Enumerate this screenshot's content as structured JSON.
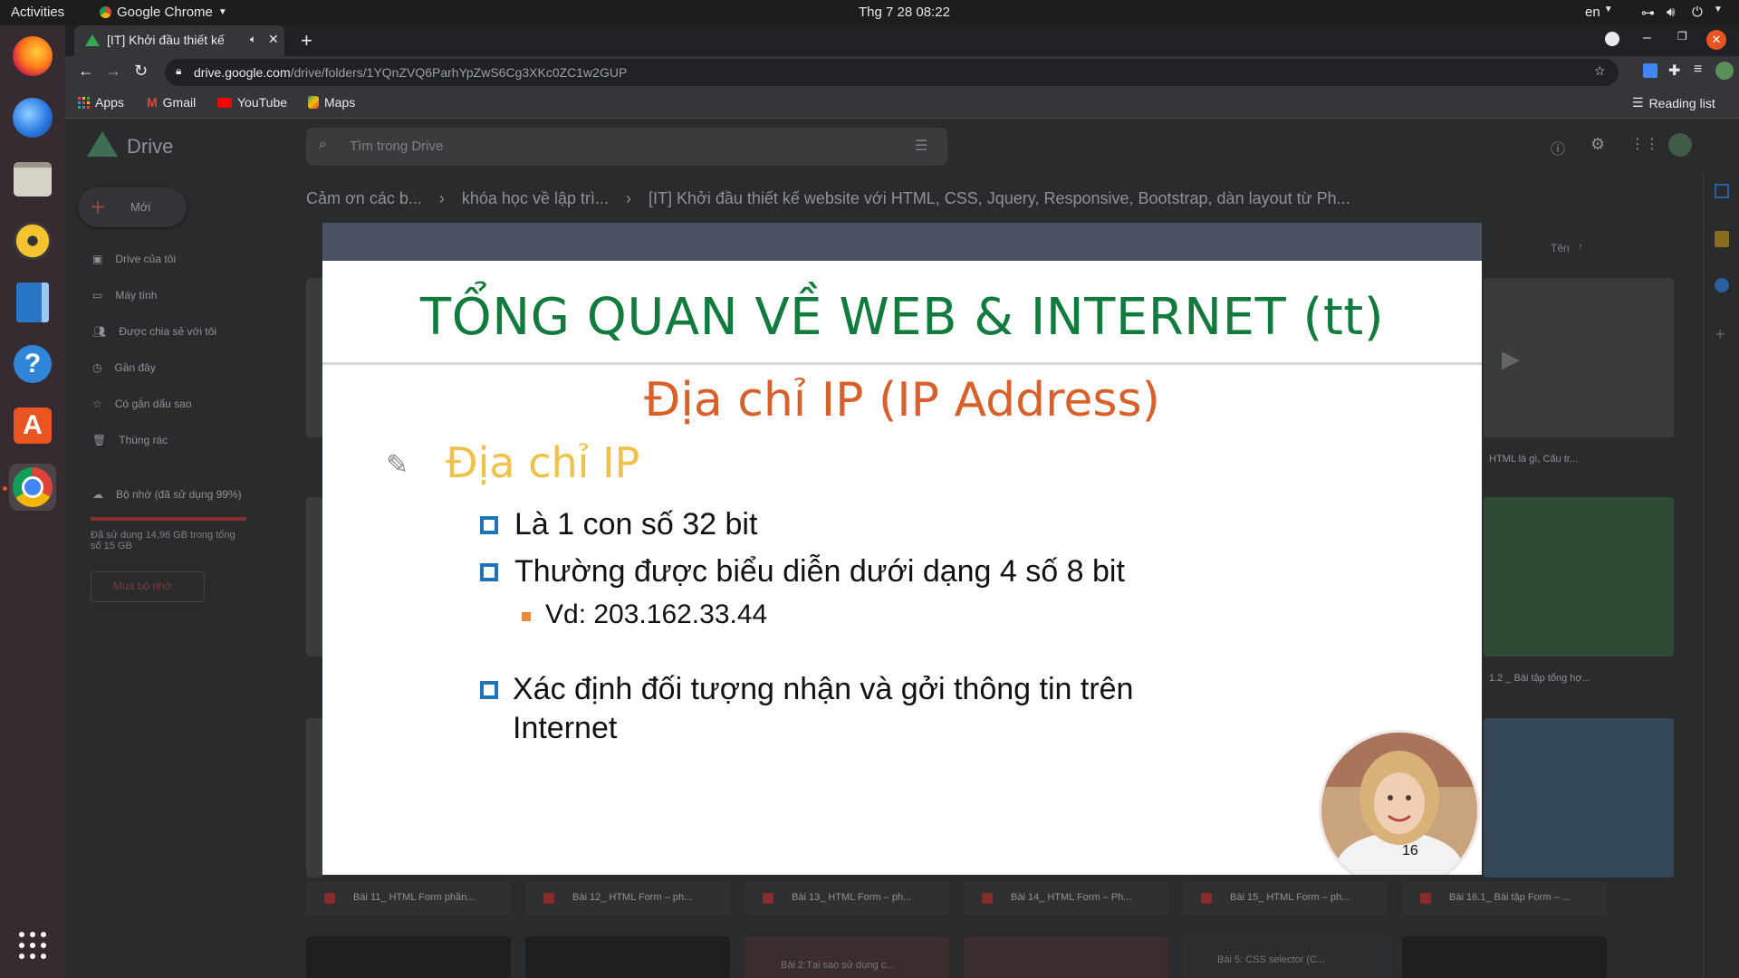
{
  "topbar": {
    "activities": "Activities",
    "app": "Google Chrome",
    "clock": "Thg 7 28  08:22",
    "lang": "en"
  },
  "chrome": {
    "tab_title": "[IT] Khởi đầu thiết kế",
    "url_host": "drive.google.com",
    "url_path": "/drive/folders/1YQnZVQ6ParhYpZwS6Cg3XKc0ZC1w2GUP",
    "bookmarks": [
      "Apps",
      "Gmail",
      "YouTube",
      "Maps"
    ],
    "reading_list": "Reading list"
  },
  "drive": {
    "logo": "Drive",
    "search_placeholder": "Tìm trong Drive",
    "new_button": "Mới",
    "breadcrumb": [
      "Cảm ơn các b...",
      "khóa học về lập trì...",
      "[IT] Khởi đầu thiết kế website với HTML, CSS, Jquery, Responsive, Bootstrap, dàn layout từ Ph..."
    ],
    "nav": [
      "Drive của tôi",
      "Máy tính",
      "Được chia sẻ với tôi",
      "Gần đây",
      "Có gắn dấu sao",
      "Thùng rác"
    ],
    "storage_label": "Bộ nhớ (đã sử dụng 99%)",
    "storage_detail": "Đã sử dụng 14,96 GB trong tổng số 15 GB",
    "storage_fill": 0.99,
    "buy_storage": "Mua bộ nhớ",
    "sort_label": "Tên",
    "file_captions": [
      "Bài 11_ HTML Form phần...",
      "Bài 12_ HTML Form – ph...",
      "Bài 13_ HTML Form – ph...",
      "Bài 14_ HTML Form – Ph...",
      "Bài 15_ HTML Form – ph...",
      "Bài 16.1_ Bài tập Form – ..."
    ],
    "side_captions": [
      "HTML là gì, Cấu tr...",
      "1.2 _ Bài tập tổng hợ..."
    ],
    "bottom_labels": [
      "Bài 2:Tại sao sử dụng c...",
      "Bài 5: CSS selector (C..."
    ]
  },
  "slide": {
    "title": "TỔNG QUAN VỀ WEB & INTERNET (tt)",
    "subtitle": "Địa chỉ IP (IP Address)",
    "heading": "Địa chỉ IP",
    "bullets": [
      "Là 1 con số 32 bit",
      "Thường được biểu diễn dưới dạng 4 số 8 bit",
      "Xác định đối tượng nhận và gởi thông tin trên",
      "Internet"
    ],
    "sub_bullet": "Vd: 203.162.33.44",
    "page_number": "16",
    "colors": {
      "title": "#117a3d",
      "subtitle": "#d8612b",
      "heading": "#f0c148",
      "bullet_box": "#1d74b8"
    }
  }
}
